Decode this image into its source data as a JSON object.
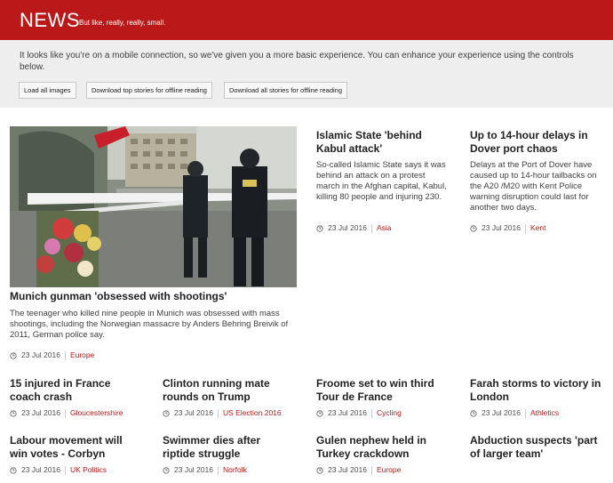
{
  "header": {
    "logo": "NEWS",
    "tagline": "But like, really, really, small.",
    "color": "#bb1919"
  },
  "notice": {
    "text": "It looks like you're on a mobile connection, so we've given you a more basic experience. You can enhance your experience using the controls below.",
    "buttons": [
      {
        "label": "Load all images"
      },
      {
        "label": "Download top stories for offline reading"
      },
      {
        "label": "Download all stories for offline reading"
      }
    ]
  },
  "stories": [
    {
      "title": "Munich gunman 'obsessed with shootings'",
      "summary": "The teenager who killed nine people in Munich was obsessed with mass shootings, including the Norwegian massacre by Anders Behring Breivik of 2011, German police say.",
      "date": "23 Jul 2016",
      "category": "Europe"
    },
    {
      "title": "Islamic State 'behind Kabul attack'",
      "summary": "So-called Islamic State says it was behind an attack on a protest march in the Afghan capital, Kabul, killing 80 people and injuring 230.",
      "date": "23 Jul 2016",
      "category": "Asia"
    },
    {
      "title": "Up to 14-hour delays in Dover port chaos",
      "summary": "Delays at the Port of Dover have caused up to 14-hour tailbacks on the A20 /M20 with Kent Police warning disruption could last for another two days.",
      "date": "23 Jul 2016",
      "category": "Kent"
    },
    {
      "title": "15 injured in France coach crash",
      "date": "23 Jul 2016",
      "category": "Gloucestershire"
    },
    {
      "title": "Clinton running mate rounds on Trump",
      "date": "23 Jul 2016",
      "category": "US Election 2016"
    },
    {
      "title": "Froome set to win third Tour de France",
      "date": "23 Jul 2016",
      "category": "Cycling"
    },
    {
      "title": "Farah storms to victory in London",
      "date": "23 Jul 2016",
      "category": "Athletics"
    },
    {
      "title": "Labour movement will win votes - Corbyn",
      "date": "23 Jul 2016",
      "category": "UK Politics"
    },
    {
      "title": "Swimmer dies after riptide struggle",
      "date": "23 Jul 2016",
      "category": "Norfolk"
    },
    {
      "title": "Gulen nephew held in Turkey crackdown",
      "date": "23 Jul 2016",
      "category": "Europe"
    },
    {
      "title": "Abduction suspects 'part of larger team'"
    }
  ],
  "icons": {
    "clock": "clock-icon"
  }
}
